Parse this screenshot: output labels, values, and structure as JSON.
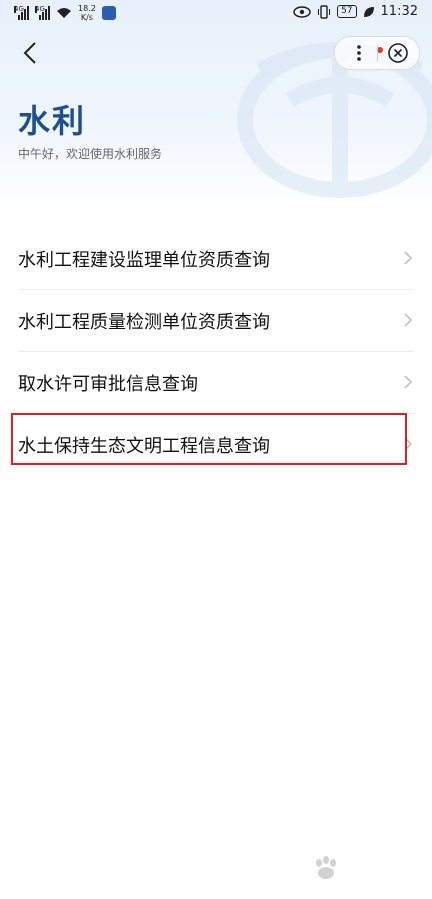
{
  "status_bar": {
    "signal_1_label": "4G",
    "signal_2_label": "4G",
    "net_speed_value": "18.2",
    "net_speed_unit": "K/s",
    "battery": "57",
    "time": "11:32"
  },
  "header": {
    "title": "水利",
    "greeting": "中午好，欢迎使用水利服务"
  },
  "menu_items": [
    {
      "label": "水利工程建设监理单位资质查询"
    },
    {
      "label": "水利工程质量检测单位资质查询"
    },
    {
      "label": "取水许可审批信息查询"
    },
    {
      "label": "水土保持生态文明工程信息查询"
    }
  ],
  "highlighted_index": 3,
  "colors": {
    "title": "#1d4f8f",
    "highlight_border": "#e02020",
    "notification_dot": "#e53935"
  },
  "icons": {
    "back": "back-arrow-icon",
    "more": "more-dots-icon",
    "close": "close-circle-icon",
    "chevron": "chevron-right-icon"
  }
}
